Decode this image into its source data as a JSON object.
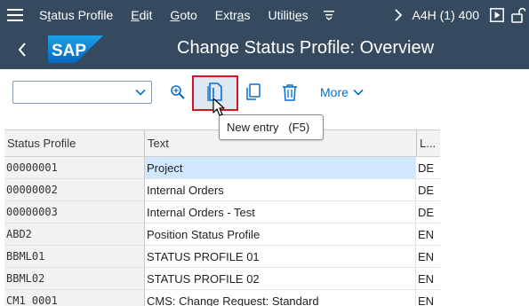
{
  "menubar": {
    "items": [
      {
        "label": "Status Profile"
      },
      {
        "label": "Edit"
      },
      {
        "label": "Goto"
      },
      {
        "label": "Extras"
      },
      {
        "label": "Utilities"
      }
    ],
    "system_info": "A4H (1) 400",
    "icons": [
      "hamburger-icon",
      "menu-more-icon",
      "chevron-right-icon",
      "play-icon",
      "unlock-icon"
    ]
  },
  "header": {
    "logo_text": "SAP",
    "title": "Change Status Profile: Overview"
  },
  "toolbar": {
    "dropdown_value": "",
    "more_label": "More",
    "icons": [
      "zoom-in-icon",
      "new-entry-icon",
      "copy-icon",
      "delete-icon"
    ]
  },
  "tooltip": {
    "text": "New entry   (F5)"
  },
  "table": {
    "columns": [
      "Status Profile",
      "Text",
      "L..."
    ],
    "rows": [
      {
        "profile": "00000001",
        "text": "Project",
        "lang": "DE"
      },
      {
        "profile": "00000002",
        "text": "Internal Orders",
        "lang": "DE"
      },
      {
        "profile": "00000003",
        "text": "Internal Orders - Test",
        "lang": "DE"
      },
      {
        "profile": "ABD2",
        "text": "Position Status Profile",
        "lang": "EN"
      },
      {
        "profile": "BBML01",
        "text": "STATUS PROFILE 01",
        "lang": "EN"
      },
      {
        "profile": "BBML02",
        "text": "STATUS PROFILE 02",
        "lang": "EN"
      },
      {
        "profile": "CM1_0001",
        "text": "CMS: Change Request: Standard",
        "lang": "EN"
      }
    ]
  },
  "colors": {
    "shell": "#354a5f",
    "accent": "#0a6ed1",
    "highlight_border": "#d9141e",
    "selected_row": "#d1e8ff"
  }
}
